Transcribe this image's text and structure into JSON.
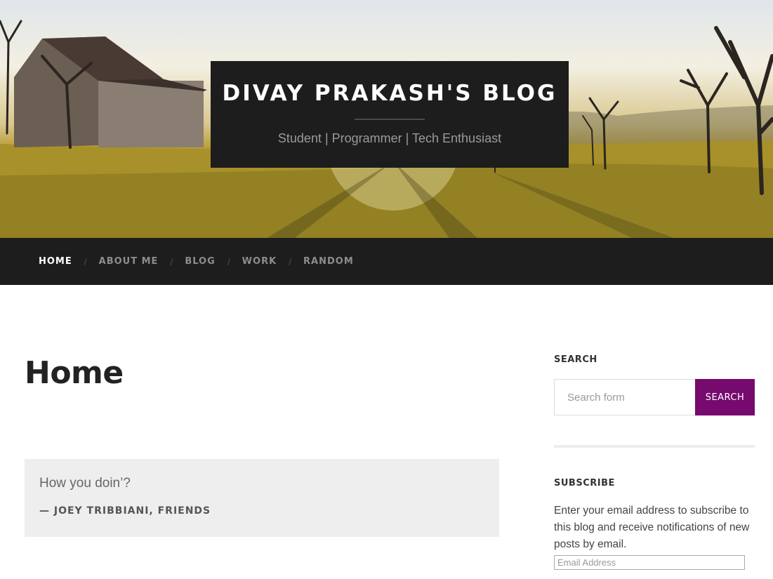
{
  "header": {
    "site_title": "DIVAY PRAKASH'S BLOG",
    "tagline": "Student | Programmer | Tech Enthusiast"
  },
  "nav": {
    "items": [
      {
        "label": "HOME",
        "active": true
      },
      {
        "label": "ABOUT ME",
        "active": false
      },
      {
        "label": "BLOG",
        "active": false
      },
      {
        "label": "WORK",
        "active": false
      },
      {
        "label": "RANDOM",
        "active": false
      }
    ],
    "separator": "/"
  },
  "main": {
    "page_title": "Home",
    "quote": {
      "text": "How you doin’?",
      "citation": "— JOEY TRIBBIANI, FRIENDS"
    }
  },
  "sidebar": {
    "search": {
      "title": "SEARCH",
      "placeholder": "Search form",
      "button_label": "SEARCH"
    },
    "subscribe": {
      "title": "SUBSCRIBE",
      "description": "Enter your email address to subscribe to this blog and receive notifications of new posts by email.",
      "email_placeholder": "Email Address"
    }
  },
  "colors": {
    "accent": "#760a6e",
    "dark_bar": "#1d1d1d",
    "quote_bg": "#eeeeee"
  }
}
